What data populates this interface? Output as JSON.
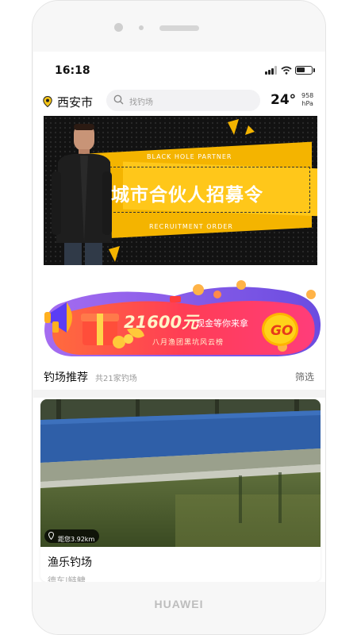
{
  "device": {
    "brand": "HUAWEI"
  },
  "status_bar": {
    "time": "16:18"
  },
  "header": {
    "city": "西安市",
    "search_placeholder": "找钓场",
    "temperature": "24°",
    "pressure_value": "958",
    "pressure_unit": "hPa"
  },
  "banner": {
    "title": "城市合伙人招募令",
    "subtitle_top": "BLACK HOLE PARTNER",
    "subtitle_bottom": "RECRUITMENT ORDER",
    "colors": {
      "accent": "#f4b400",
      "background": "#121212"
    }
  },
  "promo": {
    "amount": "21600元",
    "cash_text": "现金等你来拿",
    "subtitle": "八月渔团黑坑风云榜",
    "go_label": "GO",
    "colors": {
      "primary": "#ff3d3d",
      "secondary": "#8b5cf6"
    }
  },
  "section": {
    "title": "钓场推荐",
    "count_text": "共21家钓场",
    "filter_label": "筛选"
  },
  "listing": {
    "distance": "距您3.92km",
    "name": "渔乐钓场",
    "address": "德车|鲢鳙"
  }
}
